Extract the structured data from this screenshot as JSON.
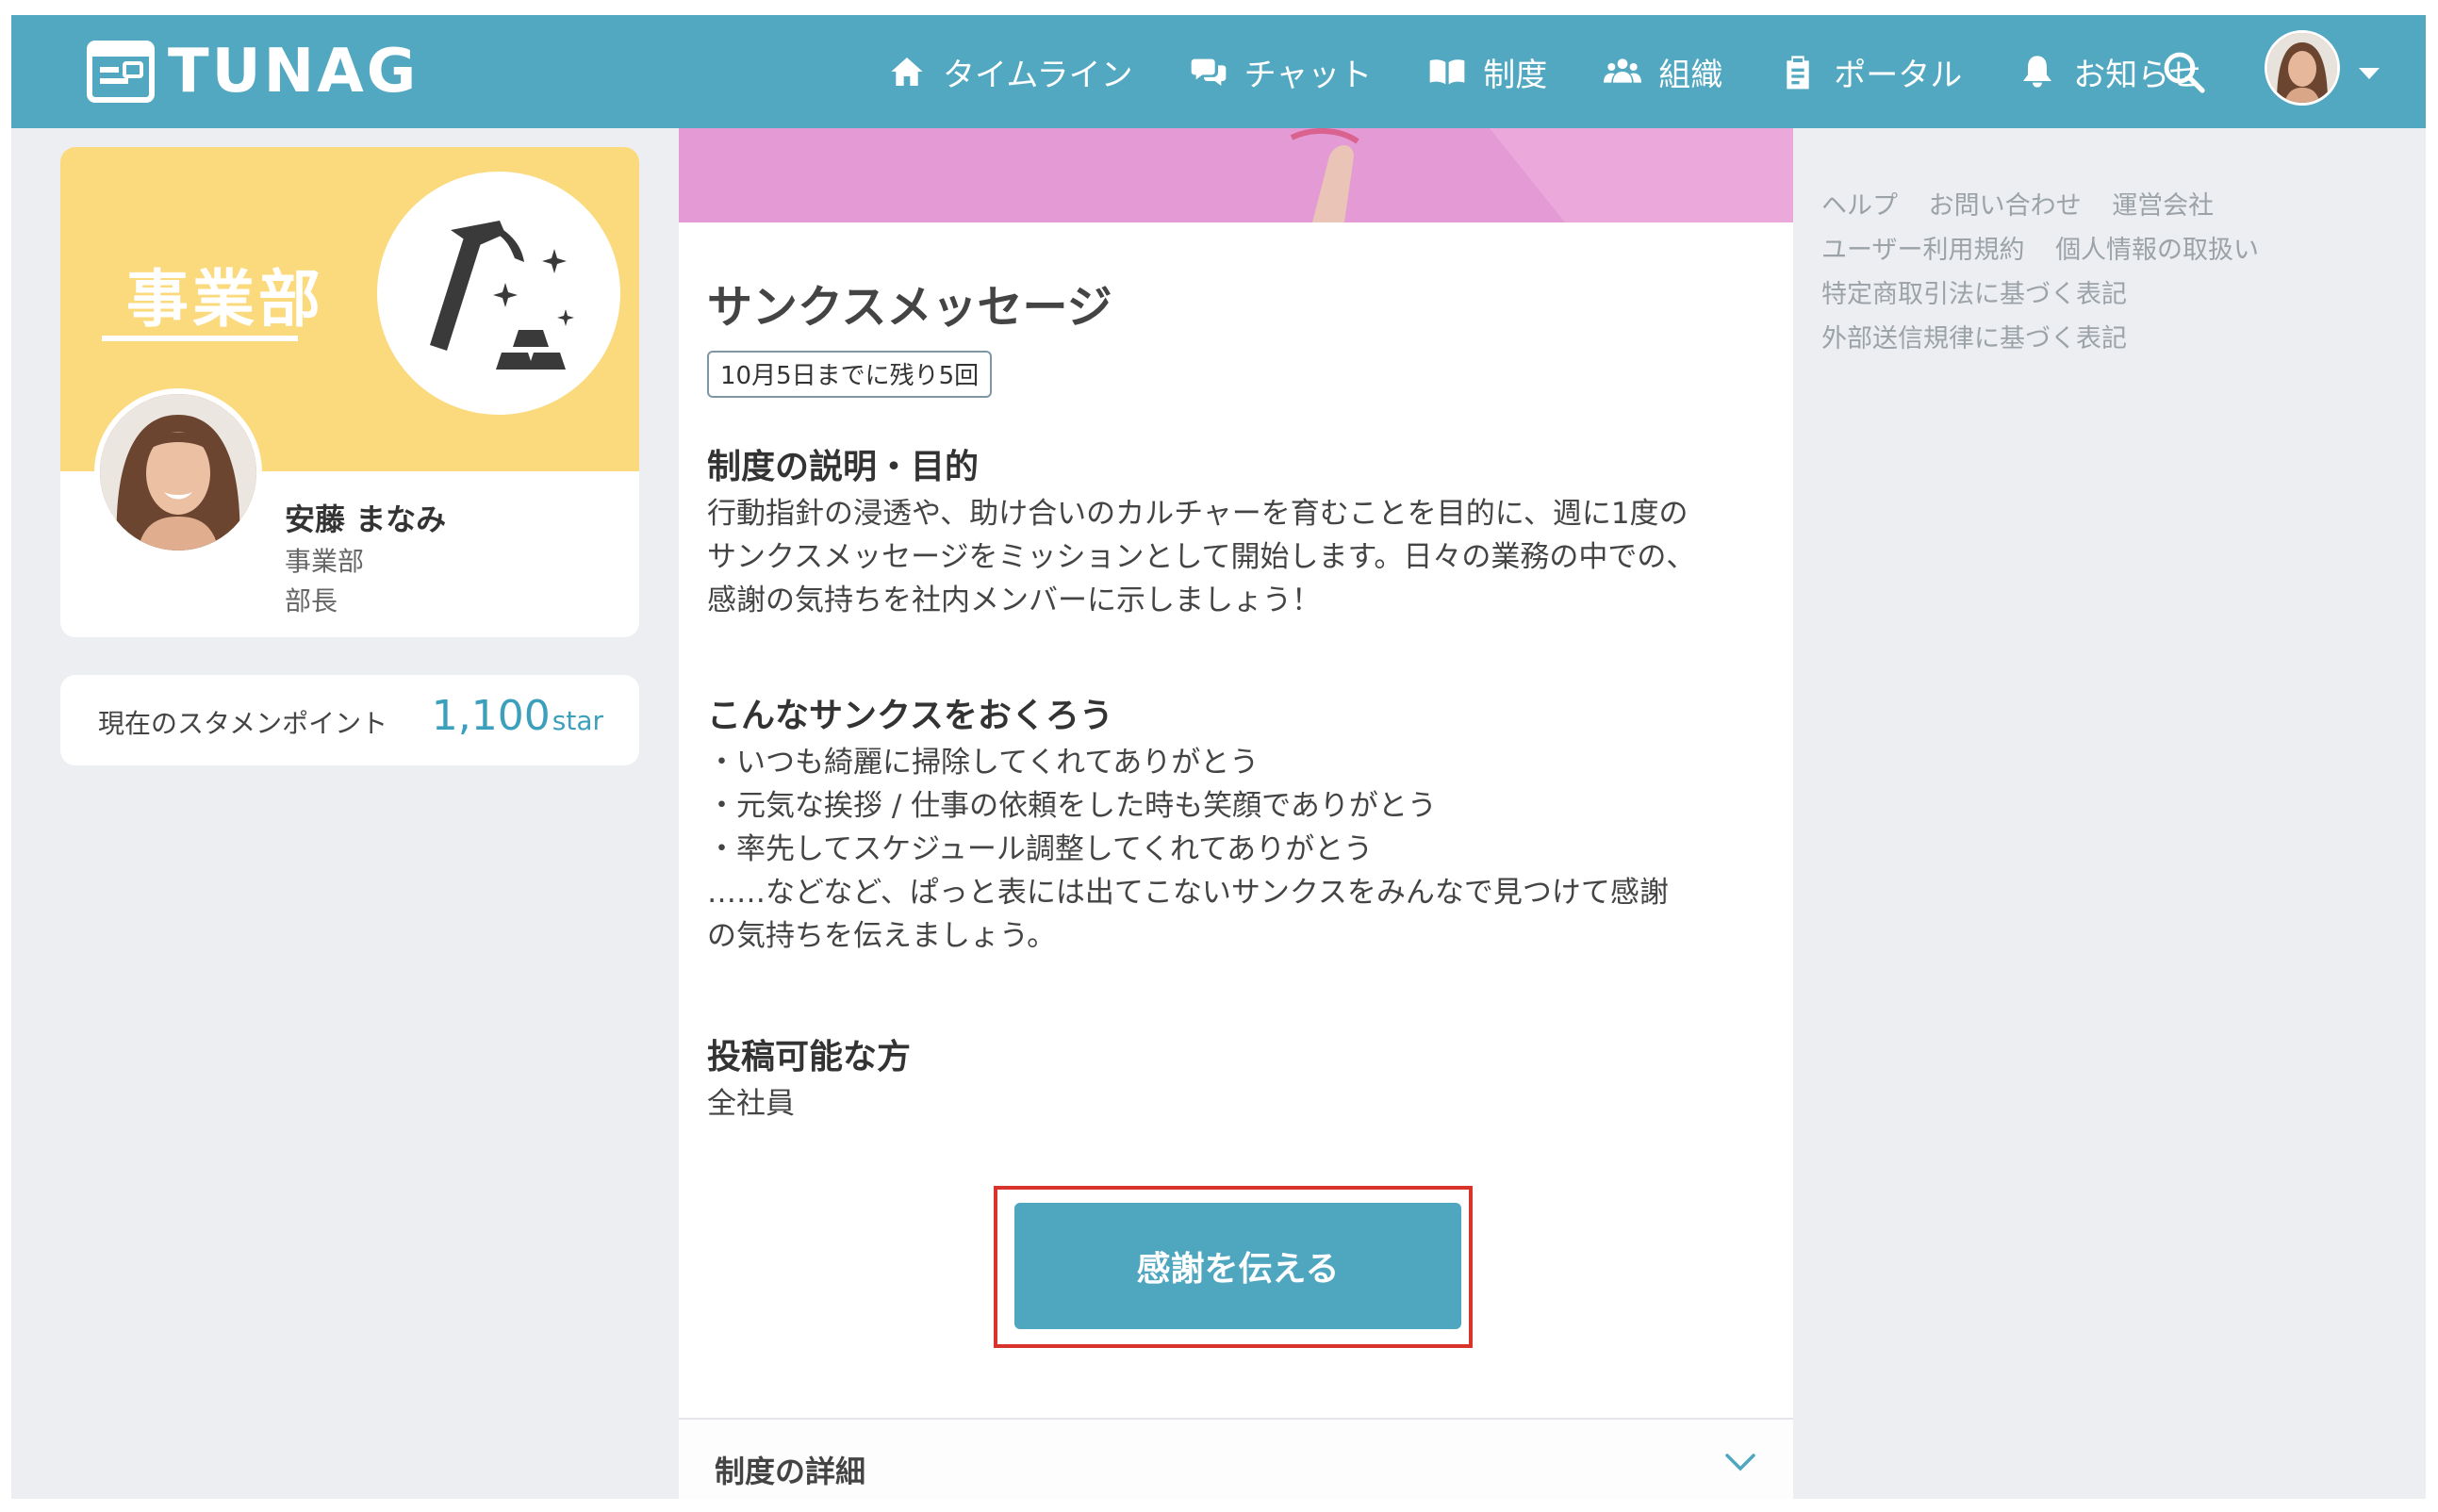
{
  "header": {
    "logo_text": "TUNAG",
    "nav": [
      {
        "label": "タイムライン",
        "icon": "home-icon"
      },
      {
        "label": "チャット",
        "icon": "chat-icon"
      },
      {
        "label": "制度",
        "icon": "book-icon"
      },
      {
        "label": "組織",
        "icon": "people-icon"
      },
      {
        "label": "ポータル",
        "icon": "clipboard-icon"
      },
      {
        "label": "お知らせ",
        "icon": "bell-icon"
      }
    ],
    "search_icon": "search-icon",
    "menu_icon": "caret-down-icon"
  },
  "profile": {
    "dept_title": "事業部",
    "badge_icon": "hammer-gold-icon",
    "name": "安藤 まなみ",
    "department": "事業部",
    "role": "部長"
  },
  "points": {
    "label": "現在のスタメンポイント",
    "value": "1,100",
    "unit": "star"
  },
  "main": {
    "title": "サンクスメッセージ",
    "limit_tag": "10月5日までに残り5回",
    "sections": [
      {
        "heading": "制度の説明・目的",
        "lines": [
          "行動指針の浸透や、助け合いのカルチャーを育むことを目的に、週に1度の",
          "サンクスメッセージをミッションとして開始します。日々の業務の中での、",
          "感謝の気持ちを社内メンバーに示しましょう！"
        ]
      },
      {
        "heading": "こんなサンクスをおくろう",
        "lines": [
          "・いつも綺麗に掃除してくれてありがとう",
          "・元気な挨拶 / 仕事の依頼をした時も笑顔でありがとう",
          "・率先してスケジュール調整してくれてありがとう",
          "……などなど、ぱっと表には出てこないサンクスをみんなで見つけて感謝",
          "の気持ちを伝えましょう。"
        ]
      },
      {
        "heading": "投稿可能な方",
        "lines": [
          "全社員"
        ]
      }
    ],
    "cta_label": "感謝を伝える",
    "details_label": "制度の詳細",
    "details_icon": "chevron-down-icon"
  },
  "footer_links": [
    [
      "ヘルプ",
      "お問い合わせ",
      "運営会社"
    ],
    [
      "ユーザー利用規約",
      "個人情報の取扱い"
    ],
    [
      "特定商取引法に基づく表記"
    ],
    [
      "外部送信規律に基づく表記"
    ]
  ],
  "colors": {
    "header": "#52a8c0",
    "banner": "#fbd97d",
    "hero": "#e49ad4",
    "cta": "#4ea6bf",
    "highlight": "#d9342b",
    "points": "#3c9fbc"
  }
}
